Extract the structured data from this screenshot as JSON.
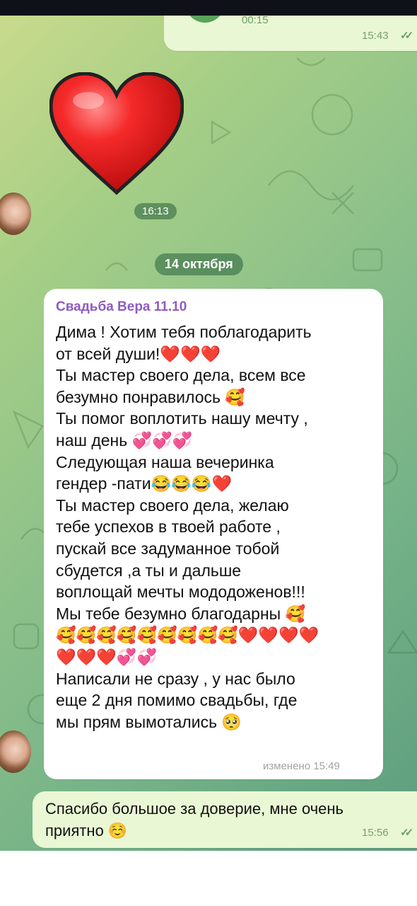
{
  "messages": {
    "top_out": {
      "duration": "00:15",
      "time": "15:43",
      "status": "read-double-check"
    },
    "heart_sticker": {
      "icon": "red-heart-icon",
      "time": "16:13"
    },
    "date_divider": "14 октября",
    "incoming": {
      "sender": "Свадьба Вера 11.10",
      "text": "Дима ! Хотим тебя поблагодарить\nот всей души!❤️❤️❤️\nТы мастер своего дела, всем все\nбезумно понравилось 🥰\nТы помог воплотить нашу мечту ,\nнаш день 💞💞💞\nСледующая наша вечеринка\nгендер -пати😂😂😂❤️\nТы мастер своего дела, желаю\nтебе успехов в твоей работе ,\nпускай все задуманное тобой\nсбудется ,а ты и дальше\nвоплощай мечты мододоженов!!!\nМы тебе безумно благодарны 🥰\n🥰🥰🥰🥰🥰🥰🥰🥰🥰❤️❤️❤️❤️\n❤️❤️❤️💞💞\nНаписали не сразу , у нас было\nеще 2 дня помимо свадьбы, где\nмы прям вымотались 🥺",
      "edited_time": "изменено 15:49"
    },
    "reply_out": {
      "text": "Спасибо большое за доверие, мне очень\nприятно ☺️",
      "time": "15:56",
      "status": "read-double-check"
    }
  },
  "colors": {
    "outgoing_bubble": "#e9f7d4",
    "incoming_bubble": "#ffffff",
    "sender_name": "#8e5bc2",
    "date_pill": "#3d7a52"
  }
}
